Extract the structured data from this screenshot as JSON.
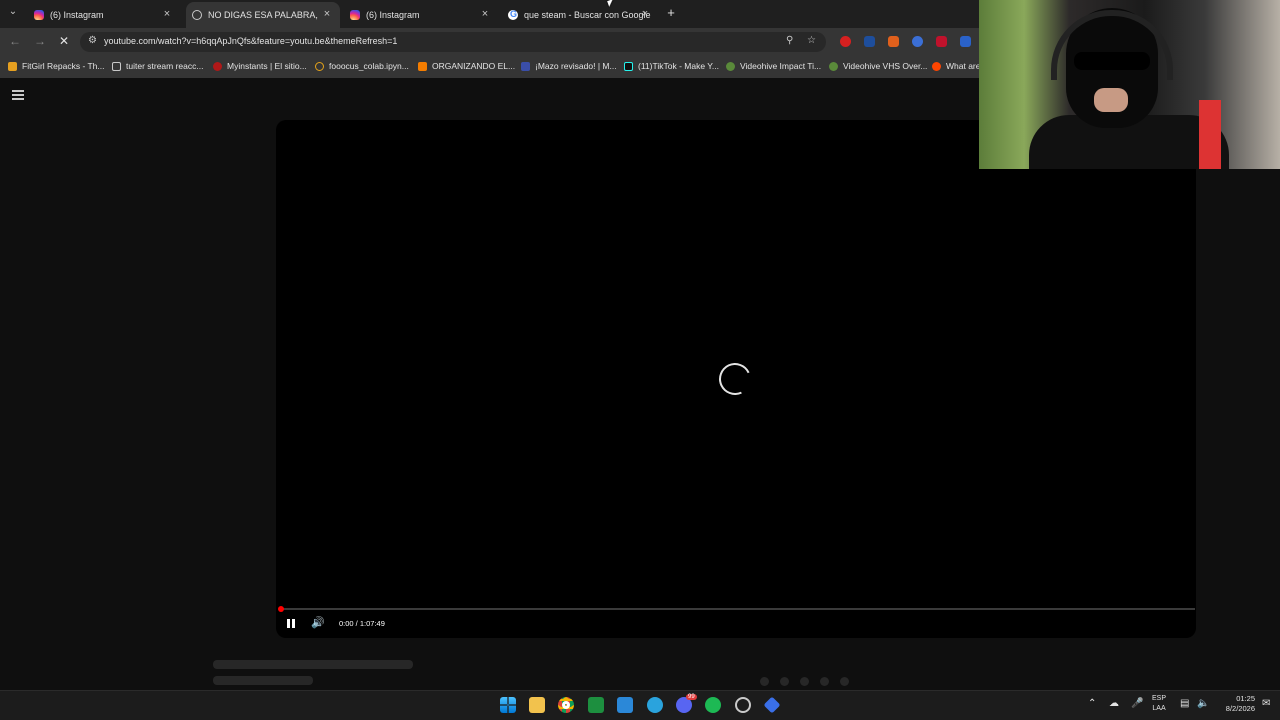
{
  "browser": {
    "tabs": [
      {
        "title": "(6) Instagram",
        "favicon": "instagram-icon"
      },
      {
        "title": "NO DIGAS ESA PALABRA, POR",
        "favicon": "youtube-loading-icon",
        "active": true
      },
      {
        "title": "(6) Instagram",
        "favicon": "instagram-icon"
      },
      {
        "title": "que steam - Buscar con Google",
        "favicon": "google-icon"
      }
    ],
    "tab_close_glyph": "×",
    "new_tab_glyph": "+",
    "tab_search_glyph": "⌄",
    "url": "youtube.com/watch?v=h6qqApJnQfs&feature=youtu.be&themeRefresh=1",
    "bookmarks": [
      "FitGirl Repacks - Th...",
      "tuiter  stream reacc...",
      "Myinstants | El sitio...",
      "fooocus_colab.ipyn...",
      "ORGANIZANDO EL...",
      "¡Mazo revisado! | M...",
      "(11)TikTok - Make Y...",
      "Videohive Impact Ti...",
      "Videohive VHS Over...",
      "What are"
    ]
  },
  "player": {
    "time_display": "0:00 / 1:07:49",
    "progress": 0.0,
    "state": "loading"
  },
  "taskbar": {
    "language_line1": "ESP",
    "language_line2": "LAA",
    "time": "01:25",
    "date": "8/2/2026",
    "notification_badge": "99"
  },
  "colors": {
    "accent_red": "#ff0000",
    "background": "#0f0f0f",
    "chrome_bar": "#353535"
  }
}
